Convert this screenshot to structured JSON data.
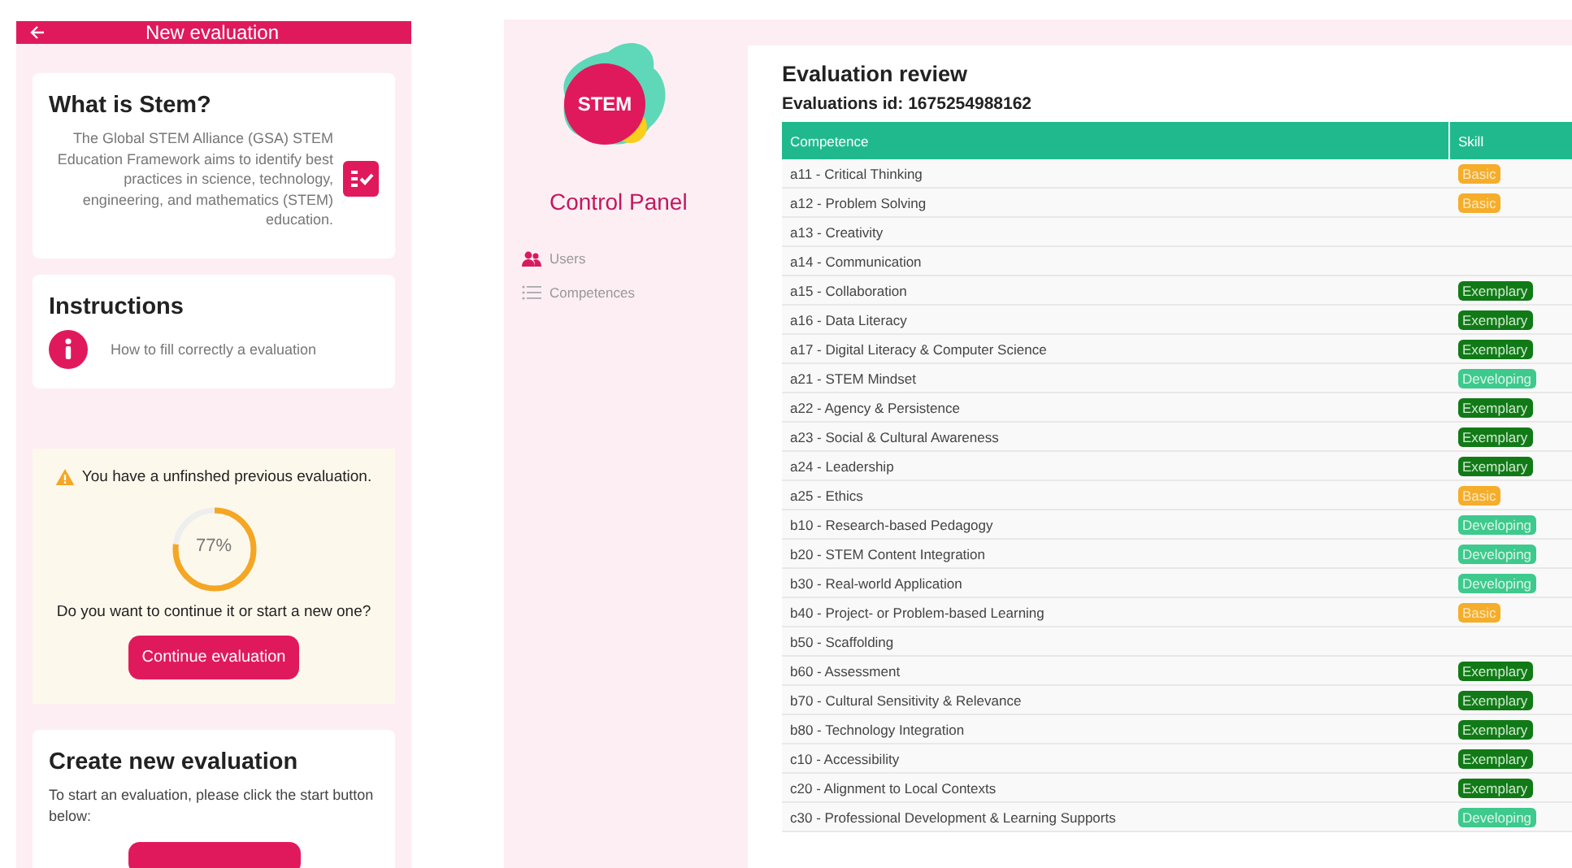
{
  "mobile": {
    "header": {
      "title": "New evaluation"
    },
    "about": {
      "title": "What is Stem?",
      "text": "The Global STEM Alliance (GSA) STEM Education Framework aims to identify best practices in science, technology, engineering, and mathematics (STEM) education."
    },
    "instructions": {
      "title": "Instructions",
      "link": "How to fill correctly a evaluation"
    },
    "unfinished": {
      "warning": "You have a unfinshed previous evaluation.",
      "progress": {
        "level": 0.77,
        "reading": "77%"
      },
      "question": "Do you want to continue it or start a new one?",
      "button": "Continue evaluation"
    },
    "create": {
      "title": "Create new evaluation",
      "text": "To start an evaluation, please click the start button below:"
    }
  },
  "sidebar": {
    "logo": "STEM",
    "title": "Control Panel",
    "items": [
      {
        "label": "Users",
        "kind": "users",
        "selected": true
      },
      {
        "label": "Competences",
        "kind": "list",
        "selected": false
      }
    ]
  },
  "review": {
    "title": "Evaluation review",
    "subtitle": "Evaluations id: 1675254988162",
    "table": {
      "columns": [
        "Competence",
        "Skill"
      ],
      "rows": [
        {
          "competence": "a11 - Critical Thinking",
          "skill": {
            "label": "Basic",
            "kind": "basic"
          }
        },
        {
          "competence": "a12 - Problem Solving",
          "skill": {
            "label": "Basic",
            "kind": "basic"
          }
        },
        {
          "competence": "a13 - Creativity"
        },
        {
          "competence": "a14 - Communication"
        },
        {
          "competence": "a15 - Collaboration",
          "skill": {
            "label": "Exemplary",
            "kind": "exemplary"
          }
        },
        {
          "competence": "a16 - Data Literacy",
          "skill": {
            "label": "Exemplary",
            "kind": "exemplary"
          }
        },
        {
          "competence": "a17 - Digital Literacy & Computer Science",
          "skill": {
            "label": "Exemplary",
            "kind": "exemplary"
          }
        },
        {
          "competence": "a21 - STEM Mindset",
          "skill": {
            "label": "Developing",
            "kind": "developing"
          }
        },
        {
          "competence": "a22 - Agency & Persistence",
          "skill": {
            "label": "Exemplary",
            "kind": "exemplary"
          }
        },
        {
          "competence": "a23 - Social & Cultural Awareness",
          "skill": {
            "label": "Exemplary",
            "kind": "exemplary"
          }
        },
        {
          "competence": "a24 - Leadership",
          "skill": {
            "label": "Exemplary",
            "kind": "exemplary"
          }
        },
        {
          "competence": "a25 - Ethics",
          "skill": {
            "label": "Basic",
            "kind": "basic"
          }
        },
        {
          "competence": "b10 - Research-based Pedagogy",
          "skill": {
            "label": "Developing",
            "kind": "developing"
          }
        },
        {
          "competence": "b20 - STEM Content Integration",
          "skill": {
            "label": "Developing",
            "kind": "developing"
          }
        },
        {
          "competence": "b30 - Real-world Application",
          "skill": {
            "label": "Developing",
            "kind": "developing"
          }
        },
        {
          "competence": "b40 - Project- or Problem-based Learning",
          "skill": {
            "label": "Basic",
            "kind": "basic"
          }
        },
        {
          "competence": "b50 - Scaffolding"
        },
        {
          "competence": "b60 - Assessment",
          "skill": {
            "label": "Exemplary",
            "kind": "exemplary"
          }
        },
        {
          "competence": "b70 - Cultural Sensitivity & Relevance",
          "skill": {
            "label": "Exemplary",
            "kind": "exemplary"
          }
        },
        {
          "competence": "b80 - Technology Integration",
          "skill": {
            "label": "Exemplary",
            "kind": "exemplary"
          }
        },
        {
          "competence": "c10 - Accessibility",
          "skill": {
            "label": "Exemplary",
            "kind": "exemplary"
          }
        },
        {
          "competence": "c20 - Alignment to Local Contexts",
          "skill": {
            "label": "Exemplary",
            "kind": "exemplary"
          }
        },
        {
          "competence": "c30 - Professional Development & Learning Supports",
          "skill": {
            "label": "Developing",
            "kind": "developing"
          }
        }
      ]
    }
  }
}
